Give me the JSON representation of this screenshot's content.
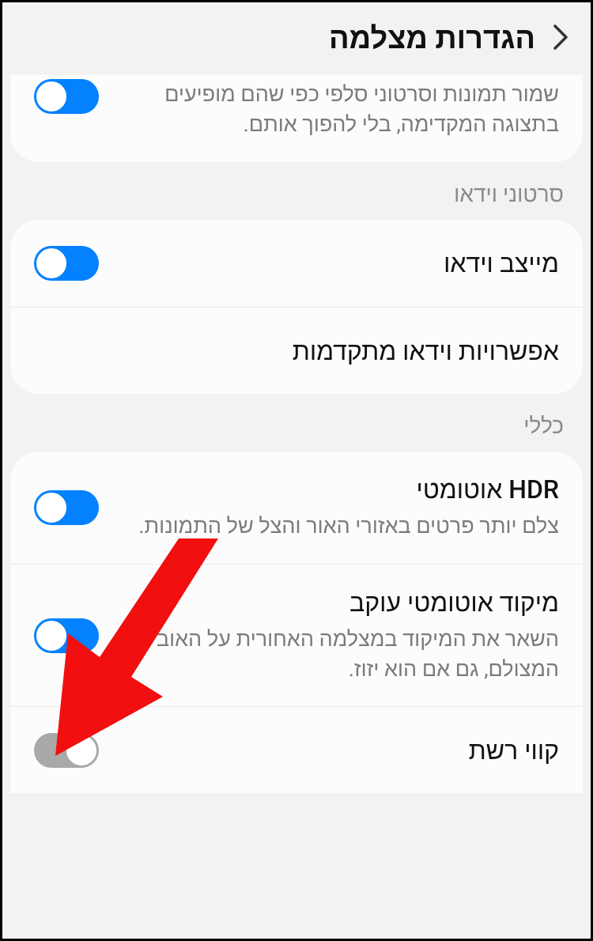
{
  "header": {
    "title": "הגדרות מצלמה"
  },
  "section_selfies": {
    "item_save_as_preview": {
      "description": "שמור תמונות וסרטוני סלפי כפי שהם מופיעים בתצוגה המקדימה, בלי להפוך אותם.",
      "on": true
    }
  },
  "section_videos": {
    "label": "סרטוני וידאו",
    "item_stabilizer": {
      "title": "מייצב וידאו",
      "on": true
    },
    "item_advanced": {
      "title": "אפשרויות וידאו מתקדמות"
    }
  },
  "section_general": {
    "label": "כללי",
    "item_hdr": {
      "title": "HDR אוטומטי",
      "description": "צלם יותר פרטים באזורי האור והצל של התמונות.",
      "on": true
    },
    "item_tracking_af": {
      "title": "מיקוד אוטומטי עוקב",
      "description": "השאר את המיקוד במצלמה האחורית על האובייקט המצולם, גם אם הוא יזוז.",
      "on": true
    },
    "item_gridlines": {
      "title": "קווי רשת",
      "on": false
    }
  },
  "colors": {
    "accent": "#0381fe",
    "arrow": "#f20f0f"
  }
}
